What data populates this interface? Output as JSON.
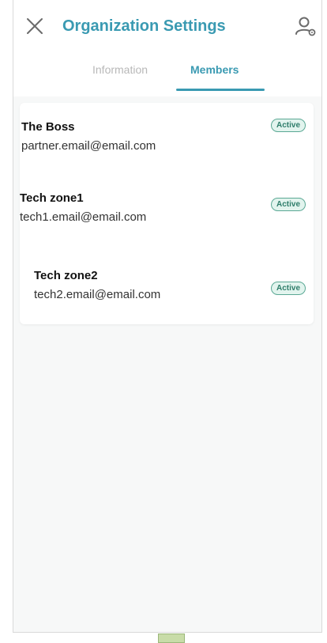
{
  "header": {
    "title": "Organization Settings",
    "close_icon": "close-icon",
    "user_icon": "user-settings-icon"
  },
  "tabs": [
    {
      "label": "Information",
      "active": false
    },
    {
      "label": "Members",
      "active": true
    }
  ],
  "members": [
    {
      "name": "The Boss",
      "email": "partner.email@email.com",
      "status": "Active"
    },
    {
      "name": "Tech zone1",
      "email": "tech1.email@email.com",
      "status": "Active"
    },
    {
      "name": "Tech zone2",
      "email": "tech2.email@email.com",
      "status": "Active"
    }
  ],
  "colors": {
    "accent": "#3a9ab2",
    "badge_text": "#2e7d6a",
    "badge_bg": "#e2f4ee",
    "inactive_tab": "#b8b8b8"
  }
}
